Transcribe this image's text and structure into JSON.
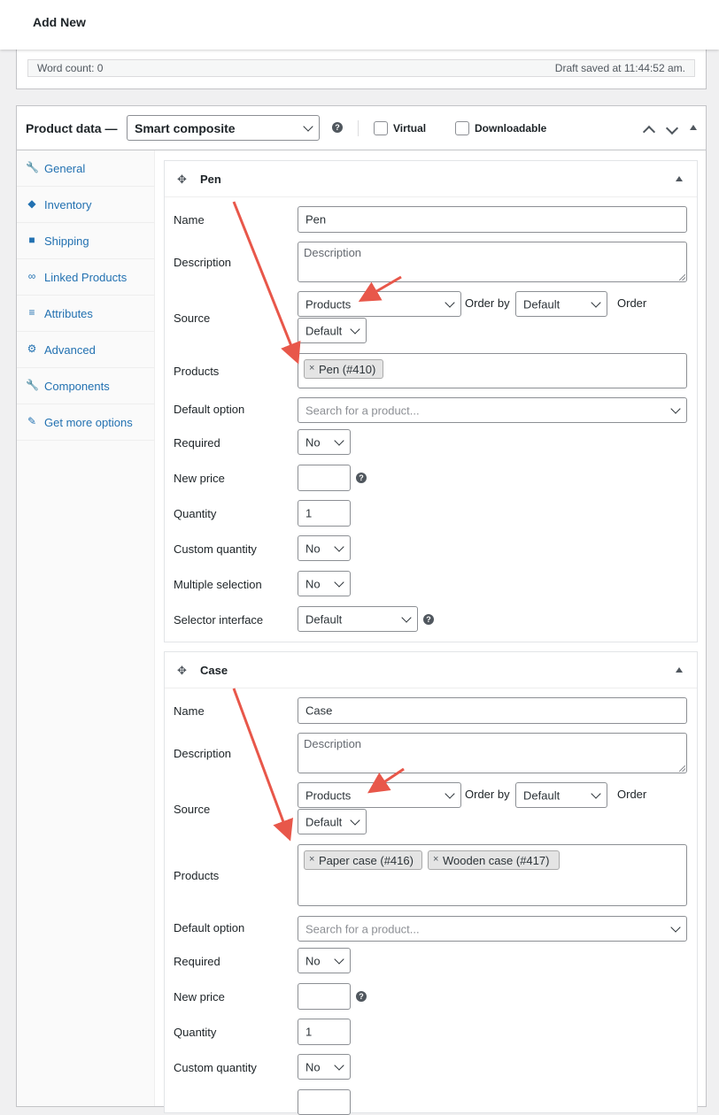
{
  "header": {
    "title": "Add New"
  },
  "editor": {
    "word_count": "Word count: 0",
    "draft_saved": "Draft saved at 11:44:52 am."
  },
  "product_data": {
    "label": "Product data —",
    "type_value": "Smart composite",
    "help_icon": "?",
    "virtual_label": "Virtual",
    "downloadable_label": "Downloadable"
  },
  "tabs": [
    {
      "label": "General",
      "icon": "wrench-icon",
      "glyph": "🔧"
    },
    {
      "label": "Inventory",
      "icon": "tag-icon",
      "glyph": "◆"
    },
    {
      "label": "Shipping",
      "icon": "truck-icon",
      "glyph": "■"
    },
    {
      "label": "Linked Products",
      "icon": "link-icon",
      "glyph": "∞"
    },
    {
      "label": "Attributes",
      "icon": "list-icon",
      "glyph": "≡"
    },
    {
      "label": "Advanced",
      "icon": "gear-icon",
      "glyph": "⚙"
    },
    {
      "label": "Components",
      "icon": "wrench-icon",
      "glyph": "🔧"
    },
    {
      "label": "Get more options",
      "icon": "plugin-icon",
      "glyph": "✎"
    }
  ],
  "labels": {
    "name": "Name",
    "description": "Description",
    "source": "Source",
    "products": "Products",
    "default_option": "Default option",
    "required": "Required",
    "new_price": "New price",
    "quantity": "Quantity",
    "custom_quantity": "Custom quantity",
    "multiple_selection": "Multiple selection",
    "selector_interface": "Selector interface",
    "order_by": "Order by",
    "order": "Order",
    "description_placeholder": "Description",
    "search_placeholder": "Search for a product...",
    "remove_x": "×",
    "help": "?",
    "move_glyph": "✥"
  },
  "components": [
    {
      "title": "Pen",
      "name": "Pen",
      "source": "Products",
      "order_by": "Default",
      "order": "Default",
      "products": [
        "Pen (#410)"
      ],
      "required": "No",
      "new_price": "",
      "quantity": "1",
      "custom_quantity": "No",
      "multiple_selection": "No",
      "selector_interface": "Default"
    },
    {
      "title": "Case",
      "name": "Case",
      "source": "Products",
      "order_by": "Default",
      "order": "Default",
      "products": [
        "Paper case (#416)",
        "Wooden case (#417)"
      ],
      "required": "No",
      "new_price": "",
      "quantity": "1",
      "custom_quantity": "No"
    }
  ],
  "colors": {
    "link": "#2271b1",
    "annotation_arrow": "#e8574a",
    "border": "#8c8f94"
  }
}
